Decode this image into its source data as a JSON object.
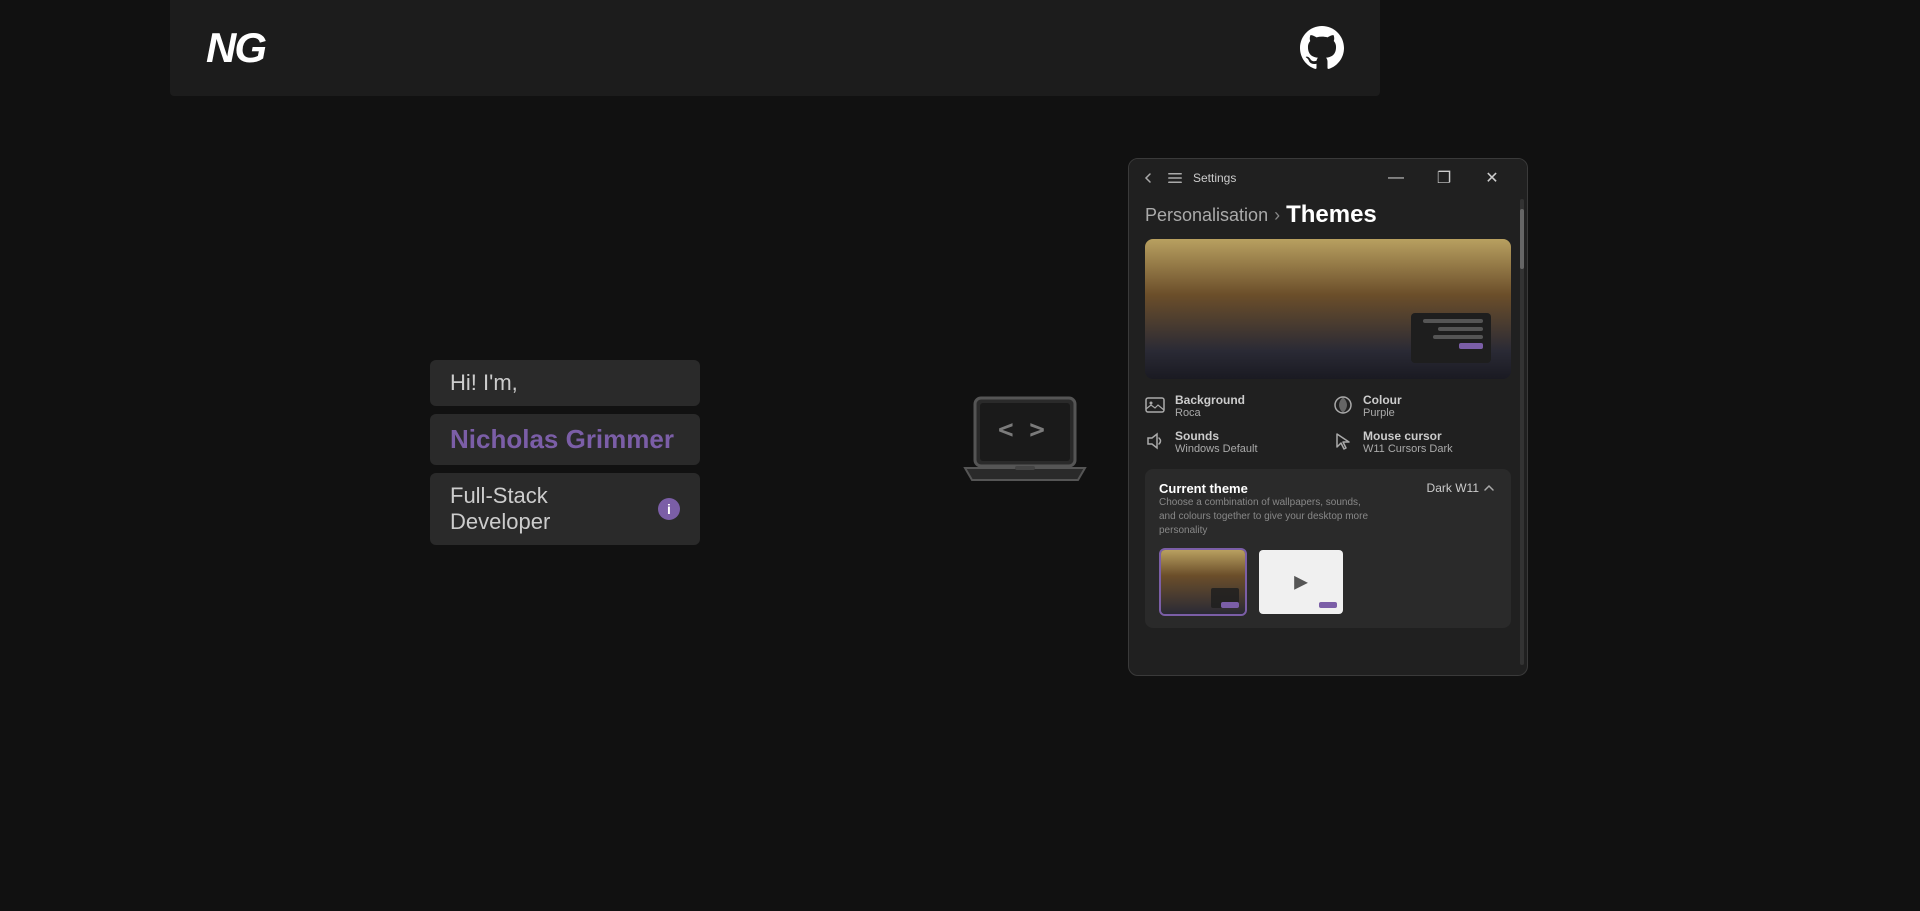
{
  "navbar": {
    "logo": "NG",
    "github_label": "GitHub"
  },
  "hero": {
    "greeting": "Hi! I'm,",
    "name": "Nicholas Grimmer",
    "title": "Full-Stack Developer",
    "info_icon": "i"
  },
  "settings_window": {
    "title": "Settings",
    "breadcrumb_parent": "Personalisation",
    "breadcrumb_current": "Themes",
    "background_label": "Background",
    "background_value": "Roca",
    "colour_label": "Colour",
    "colour_value": "Purple",
    "sounds_label": "Sounds",
    "sounds_value": "Windows Default",
    "mouse_cursor_label": "Mouse cursor",
    "mouse_cursor_value": "W11 Cursors Dark",
    "current_theme_title": "Current theme",
    "current_theme_desc": "Choose a combination of wallpapers, sounds, and colours together to give your desktop more personality",
    "current_theme_name": "Dark W11",
    "titlebar_minimize": "—",
    "titlebar_maximize": "❐",
    "titlebar_close": "✕"
  }
}
